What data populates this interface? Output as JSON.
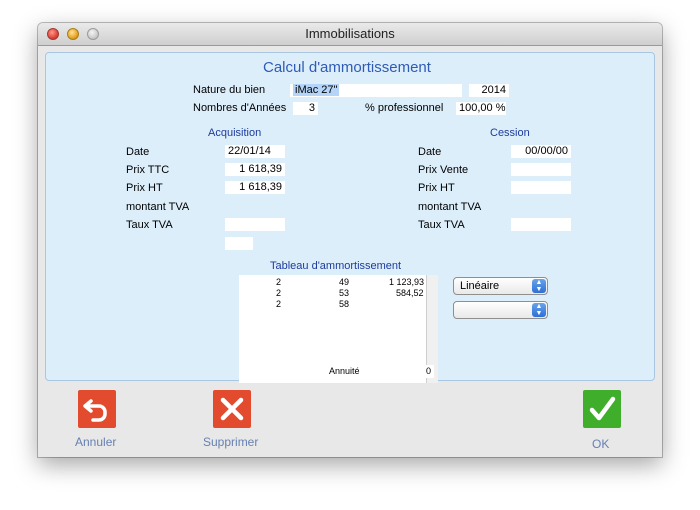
{
  "window": {
    "title": "Immobilisations"
  },
  "header": {
    "heading": "Calcul d'ammortissement",
    "nature_label": "Nature du bien",
    "nature_value": "iMac 27\"",
    "year_value": "2014",
    "years_label": "Nombres d'Années",
    "years_value": "3",
    "pro_label": "% professionnel",
    "pro_value": "100,00 %"
  },
  "acquisition": {
    "title": "Acquisition",
    "date_label": "Date",
    "date_value": "22/01/14",
    "ttc_label": "Prix TTC",
    "ttc_value": "1 618,39",
    "ht_label": "Prix HT",
    "ht_value": "1 618,39",
    "tva_amount_label": "montant TVA",
    "tva_amount_value": "",
    "tva_rate_label": "Taux TVA",
    "tva_rate_value": "",
    "extra_value": ""
  },
  "cession": {
    "title": "Cession",
    "date_label": "Date",
    "date_value": "00/00/00",
    "sale_label": "Prix Vente",
    "sale_value": "",
    "ht_label": "Prix HT",
    "ht_value": "",
    "tva_amount_label": "montant TVA",
    "tva_rate_label": "Taux TVA",
    "tva_rate_value": ""
  },
  "table": {
    "title": "Tableau d'ammortissement",
    "rows": [
      {
        "a": "2",
        "b": "49",
        "c": "1 123,93"
      },
      {
        "a": "2",
        "b": "53",
        "c": "584,52"
      },
      {
        "a": "2",
        "b": "58",
        "c": ""
      }
    ],
    "annuity_label": "Annuité",
    "annuity_value": "0"
  },
  "method_select": {
    "value": "Linéaire"
  },
  "second_select": {
    "value": ""
  },
  "buttons": {
    "cancel": "Annuler",
    "delete": "Supprimer",
    "ok": "OK"
  },
  "colors": {
    "panel_bg": "#ddeefb",
    "cancel_red": "#e34b2f",
    "ok_green": "#3fae2a",
    "label_blue": "#6680b3"
  }
}
